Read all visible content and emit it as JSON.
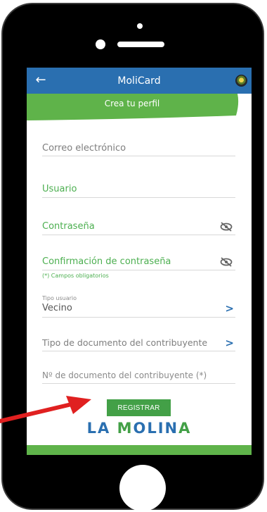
{
  "app": {
    "title": "MoliCard",
    "back_icon": "arrow-left-icon",
    "logo_icon": "municipality-seal-icon"
  },
  "banner": {
    "text": "Crea tu perfil"
  },
  "form": {
    "email_label": "Correo electrónico",
    "user_label": "Usuario",
    "password_label": "Contraseña",
    "confirm_password_label": "Confirmación de contraseña",
    "required_note": "(*) Campos obligatorios",
    "user_type_caption": "Tipo usuario",
    "user_type_value": "Vecino",
    "document_type_label": "Tipo de documento del contribuyente",
    "document_number_label": "Nº de documento del contribuyente (*)"
  },
  "actions": {
    "register_label": "REGISTRAR"
  },
  "brand": {
    "part1": "LA ",
    "part2": "M",
    "part3": "O",
    "part4": "LIN",
    "part5": "A"
  },
  "colors": {
    "primary_blue": "#2a6fb0",
    "accent_green": "#43a047",
    "annotation_red": "#e02020"
  }
}
